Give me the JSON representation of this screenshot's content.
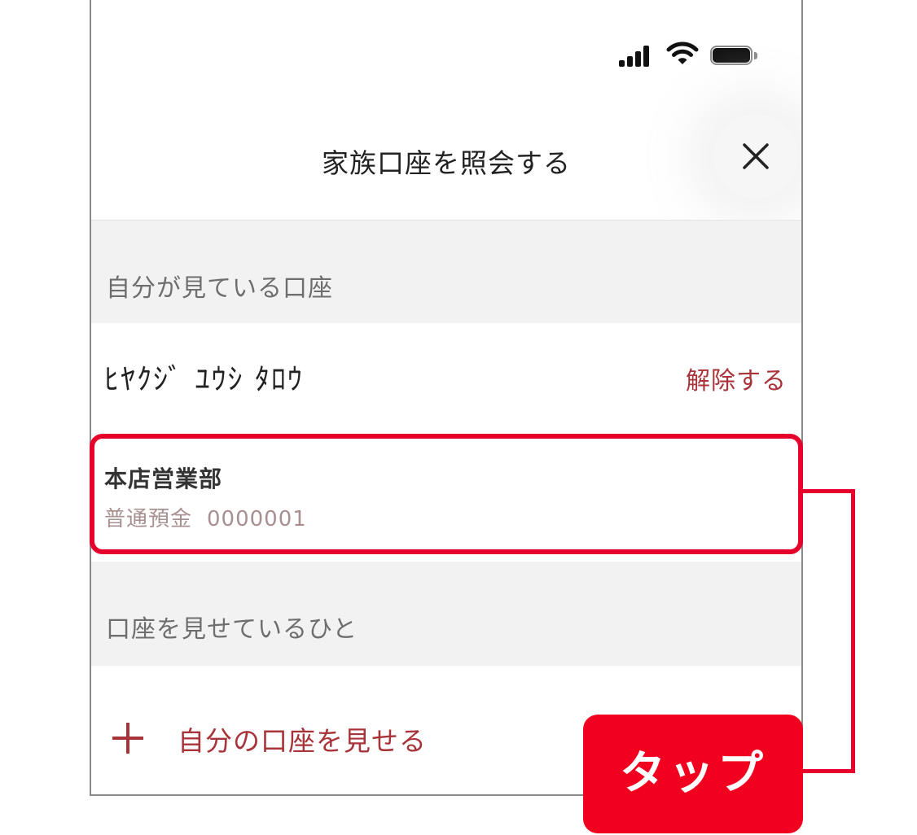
{
  "header": {
    "title": "家族口座を照会する",
    "close_icon": "close-icon"
  },
  "sections": {
    "watching": {
      "label": "自分が見ている口座"
    },
    "sharing": {
      "label": "口座を見せているひと"
    }
  },
  "account": {
    "owner_name": "ﾋﾔｸｼﾞ ﾕｳｼ ﾀﾛｳ",
    "release_label": "解除する",
    "branch": "本店営業部",
    "type": "普通預金",
    "number": "0000001"
  },
  "add": {
    "label": "自分の口座を見せる"
  },
  "annotation": {
    "tap_label": "タップ"
  },
  "colors": {
    "accent": "#a8343a",
    "highlight": "#e8002d",
    "badge": "#f2001f"
  }
}
